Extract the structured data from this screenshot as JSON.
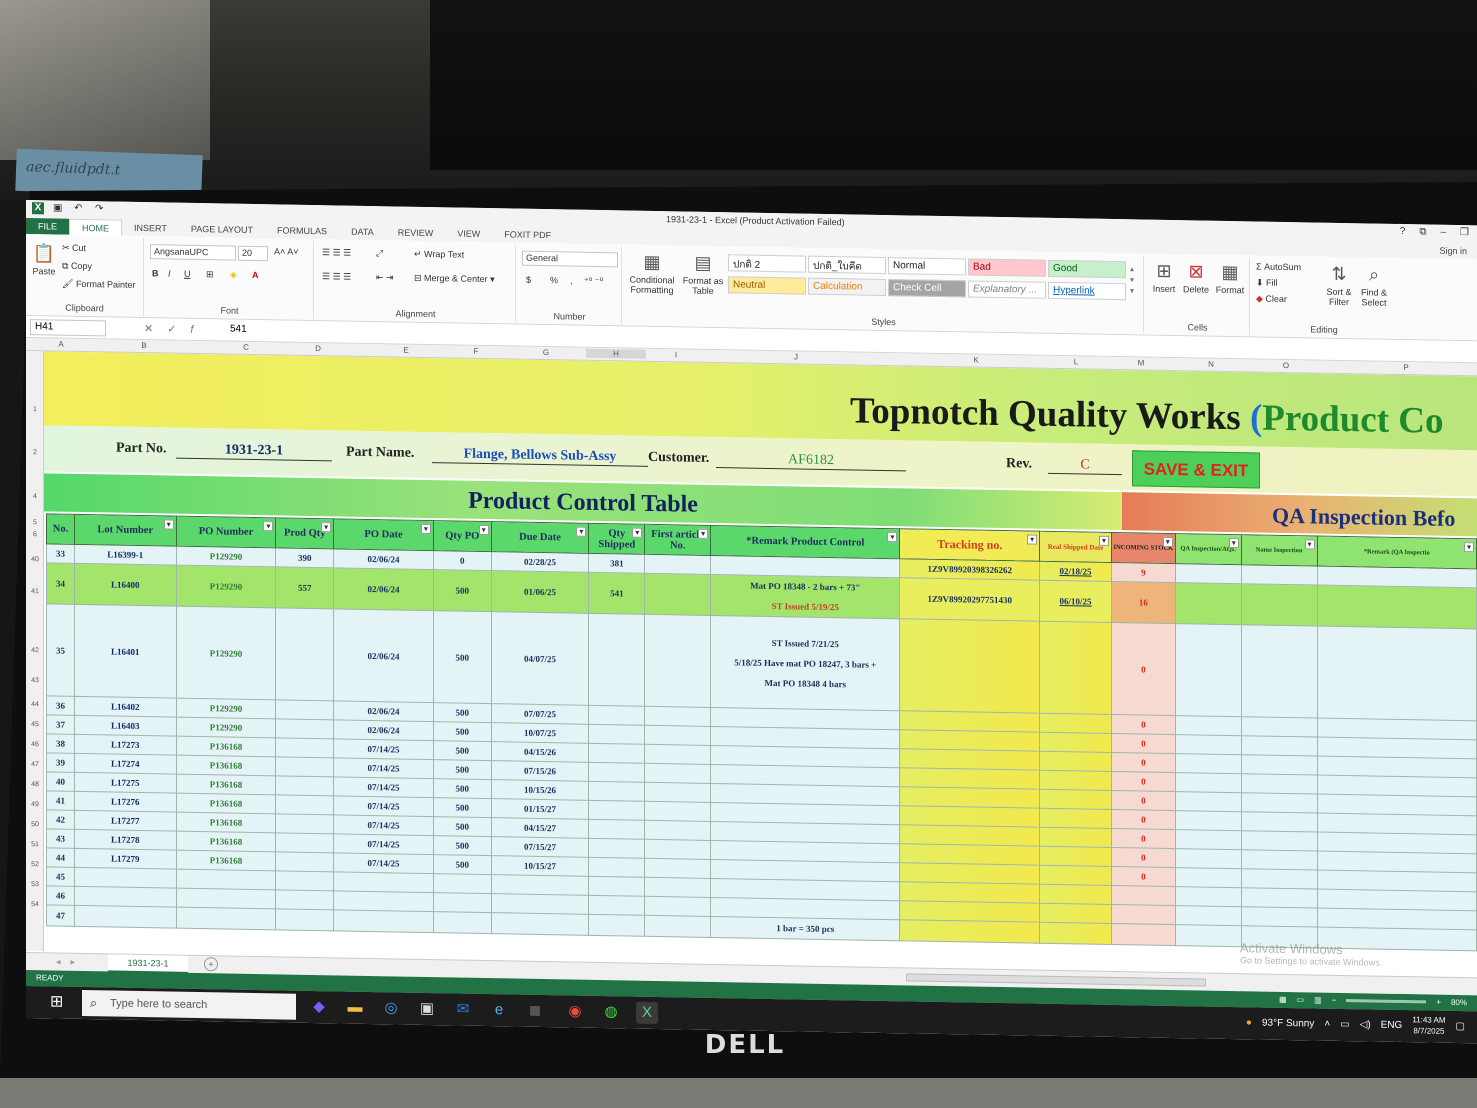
{
  "window": {
    "title": "1931-23-1 - Excel (Product Activation Failed)",
    "controls": [
      "?",
      "⧉",
      "–",
      "❐"
    ],
    "sign_in": "Sign in"
  },
  "tabs": [
    "FILE",
    "HOME",
    "INSERT",
    "PAGE LAYOUT",
    "FORMULAS",
    "DATA",
    "REVIEW",
    "VIEW",
    "FOXIT PDF"
  ],
  "ribbon": {
    "clipboard": {
      "paste": "Paste",
      "cut": "Cut",
      "copy": "Copy",
      "format_painter": "Format Painter",
      "label": "Clipboard"
    },
    "font": {
      "name": "AngsanaUPC",
      "size": "20",
      "bold": "B",
      "italic": "I",
      "underline": "U",
      "label": "Font"
    },
    "alignment": {
      "wrap_text": "Wrap Text",
      "merge_center": "Merge & Center",
      "label": "Alignment"
    },
    "number": {
      "format": "General",
      "currency": "$",
      "percent": "%",
      "comma": ",",
      "label": "Number"
    },
    "styles": {
      "conditional": [
        "Conditional",
        "Formatting"
      ],
      "format_table": [
        "Format as",
        "Table"
      ],
      "label": "Styles",
      "cells": [
        {
          "text": "ปกติ 2",
          "bg": "#ffffff",
          "fg": "#222222"
        },
        {
          "text": "ปกติ_ใบคีดคา...",
          "bg": "#ffffff",
          "fg": "#222222"
        },
        {
          "text": "Normal",
          "bg": "#ffffff",
          "fg": "#222222"
        },
        {
          "text": "Bad",
          "bg": "#ffc7ce",
          "fg": "#9c0006"
        },
        {
          "text": "Good",
          "bg": "#c6efce",
          "fg": "#006100"
        },
        {
          "text": "Neutral",
          "bg": "#ffeb9c",
          "fg": "#9c5700"
        },
        {
          "text": "Calculation",
          "bg": "#f2f2f2",
          "fg": "#fa7d00"
        },
        {
          "text": "Check Cell",
          "bg": "#a5a5a5",
          "fg": "#ffffff"
        },
        {
          "text": "Explanatory ...",
          "bg": "#ffffff",
          "fg": "#7f7f7f"
        },
        {
          "text": "Hyperlink",
          "bg": "#ffffff",
          "fg": "#0563c1"
        }
      ]
    },
    "cells": {
      "insert": "Insert",
      "delete": "Delete",
      "format": "Format",
      "label": "Cells"
    },
    "editing": {
      "autosum": "AutoSum",
      "fill": "Fill",
      "clear": "Clear",
      "sort": [
        "Sort &",
        "Filter"
      ],
      "find": [
        "Find &",
        "Select"
      ],
      "label": "Editing"
    }
  },
  "formula_bar": {
    "cell": "H41",
    "value": "541"
  },
  "columns": [
    "A",
    "B",
    "C",
    "D",
    "E",
    "F",
    "G",
    "H",
    "I",
    "J",
    "K",
    "L",
    "M",
    "N",
    "O",
    "P"
  ],
  "row_numbers": [
    "1",
    "2",
    "4",
    "5",
    "6",
    "40",
    "41",
    "42",
    "43",
    "44",
    "45",
    "46",
    "47",
    "48",
    "49",
    "50",
    "51",
    "52",
    "53",
    "54"
  ],
  "header": {
    "company": "Topnotch Quality Works",
    "paren": "(",
    "subtitle": "Product Co",
    "part_no_label": "Part No.",
    "part_no": "1931-23-1",
    "part_name_label": "Part Name.",
    "part_name": "Flange, Bellows Sub-Assy",
    "customer_label": "Customer.",
    "customer": "AF6182",
    "rev_label": "Rev.",
    "rev": "C",
    "save_exit": "SAVE & EXIT",
    "section_left": "Product Control Table",
    "section_right": "QA Inspection Befo"
  },
  "table_headers": [
    "No.",
    "Lot Number",
    "PO Number",
    "Prod Qty",
    "PO Date",
    "Qty PO",
    "Due Date",
    "Qty Shipped",
    "First article No.",
    "*Remark Product Control",
    "Tracking no.",
    "Real Shipped Date",
    "INCOMING STOCK",
    "QA Inspection/AQL",
    "Name Inspection",
    "*Remark (QA Inspectio"
  ],
  "rows": [
    {
      "no": "33",
      "lot": "L16399-1",
      "po": "P129290",
      "prod": "390",
      "po_date": "02/06/24",
      "qty_po": "0",
      "due": "02/28/25",
      "shipped": "381",
      "first": "",
      "remark": [],
      "tracking": "1Z9V89920398326262",
      "real_ship": "02/18/25",
      "incoming": "9"
    },
    {
      "no": "34",
      "lot": "L16400",
      "po": "P129290",
      "prod": "557",
      "po_date": "02/06/24",
      "qty_po": "500",
      "due": "01/06/25",
      "shipped": "541",
      "first": "",
      "remark": [
        "Mat PO 18348 - 2 bars + 73\""
      ],
      "remark_red": "ST Issued 5/19/25",
      "tracking": "1Z9V89920297751430",
      "real_ship": "06/10/25",
      "incoming": "16"
    },
    {
      "no": "35",
      "lot": "L16401",
      "po": "P129290",
      "prod": "",
      "po_date": "02/06/24",
      "qty_po": "500",
      "due": "04/07/25",
      "shipped": "",
      "first": "",
      "remark": [
        "ST Issued 7/21/25",
        "5/18/25 Have mat PO 18247, 3 bars +",
        "Mat PO 18348 4 bars"
      ],
      "tracking": "",
      "real_ship": "",
      "incoming": "0"
    },
    {
      "no": "36",
      "lot": "L16402",
      "po": "P129290",
      "prod": "",
      "po_date": "02/06/24",
      "qty_po": "500",
      "due": "07/07/25",
      "shipped": "",
      "first": "",
      "remark": [],
      "tracking": "",
      "real_ship": "",
      "incoming": "0"
    },
    {
      "no": "37",
      "lot": "L16403",
      "po": "P129290",
      "prod": "",
      "po_date": "02/06/24",
      "qty_po": "500",
      "due": "10/07/25",
      "shipped": "",
      "first": "",
      "remark": [],
      "tracking": "",
      "real_ship": "",
      "incoming": "0"
    },
    {
      "no": "38",
      "lot": "L17273",
      "po": "P136168",
      "prod": "",
      "po_date": "07/14/25",
      "qty_po": "500",
      "due": "04/15/26",
      "shipped": "",
      "first": "",
      "remark": [],
      "tracking": "",
      "real_ship": "",
      "incoming": "0"
    },
    {
      "no": "39",
      "lot": "L17274",
      "po": "P136168",
      "prod": "",
      "po_date": "07/14/25",
      "qty_po": "500",
      "due": "07/15/26",
      "shipped": "",
      "first": "",
      "remark": [],
      "tracking": "",
      "real_ship": "",
      "incoming": "0"
    },
    {
      "no": "40",
      "lot": "L17275",
      "po": "P136168",
      "prod": "",
      "po_date": "07/14/25",
      "qty_po": "500",
      "due": "10/15/26",
      "shipped": "",
      "first": "",
      "remark": [],
      "tracking": "",
      "real_ship": "",
      "incoming": "0"
    },
    {
      "no": "41",
      "lot": "L17276",
      "po": "P136168",
      "prod": "",
      "po_date": "07/14/25",
      "qty_po": "500",
      "due": "01/15/27",
      "shipped": "",
      "first": "",
      "remark": [],
      "tracking": "",
      "real_ship": "",
      "incoming": "0"
    },
    {
      "no": "42",
      "lot": "L17277",
      "po": "P136168",
      "prod": "",
      "po_date": "07/14/25",
      "qty_po": "500",
      "due": "04/15/27",
      "shipped": "",
      "first": "",
      "remark": [],
      "tracking": "",
      "real_ship": "",
      "incoming": "0"
    },
    {
      "no": "43",
      "lot": "L17278",
      "po": "P136168",
      "prod": "",
      "po_date": "07/14/25",
      "qty_po": "500",
      "due": "07/15/27",
      "shipped": "",
      "first": "",
      "remark": [],
      "tracking": "",
      "real_ship": "",
      "incoming": "0"
    },
    {
      "no": "44",
      "lot": "L17279",
      "po": "P136168",
      "prod": "",
      "po_date": "07/14/25",
      "qty_po": "500",
      "due": "10/15/27",
      "shipped": "",
      "first": "",
      "remark": [],
      "tracking": "",
      "real_ship": "",
      "incoming": "0"
    },
    {
      "no": "45",
      "lot": "",
      "po": "",
      "prod": "",
      "po_date": "",
      "qty_po": "",
      "due": "",
      "shipped": "",
      "first": "",
      "remark": [],
      "tracking": "",
      "real_ship": "",
      "incoming": ""
    },
    {
      "no": "46",
      "lot": "",
      "po": "",
      "prod": "",
      "po_date": "",
      "qty_po": "",
      "due": "",
      "shipped": "",
      "first": "",
      "remark": [],
      "tracking": "",
      "real_ship": "",
      "incoming": ""
    },
    {
      "no": "47",
      "lot": "",
      "po": "",
      "prod": "",
      "po_date": "",
      "qty_po": "",
      "due": "",
      "shipped": "",
      "first": "",
      "remark": [
        "1 bar = 350 pcs"
      ],
      "tracking": "",
      "real_ship": "",
      "incoming": ""
    }
  ],
  "watermark": {
    "line1": "Activate Windows",
    "line2": "Go to Settings to activate Windows."
  },
  "sheet_tab": "1931-23-1",
  "status": {
    "ready": "READY",
    "zoom": "80%"
  },
  "taskbar": {
    "search_placeholder": "Type here to search",
    "weather": "93°F  Sunny",
    "lang": "ENG",
    "time": "11:43 AM",
    "date": "8/7/2025"
  },
  "monitor_brand": "DELL",
  "sticky_note": "aec.fluidpdt.t"
}
